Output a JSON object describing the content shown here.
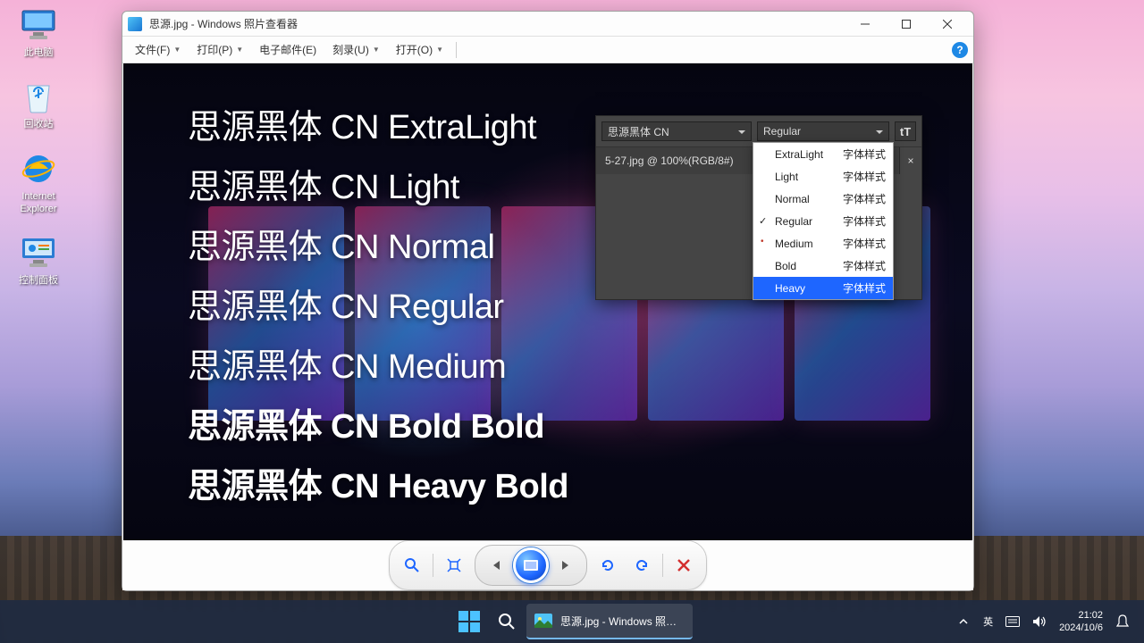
{
  "desktop": {
    "icons": [
      {
        "label": "此电脑"
      },
      {
        "label": "回收站"
      },
      {
        "label": "Internet\nExplorer"
      },
      {
        "label": "控制面板"
      }
    ]
  },
  "window": {
    "title": "思源.jpg - Windows 照片查看器",
    "menu": {
      "file": "文件(F)",
      "print": "打印(P)",
      "email": "电子邮件(E)",
      "burn": "刻录(U)",
      "open": "打开(O)"
    },
    "samples": [
      "思源黑体 CN ExtraLight",
      "思源黑体 CN Light",
      "思源黑体 CN Normal",
      "思源黑体 CN Regular",
      "思源黑体 CN Medium",
      "思源黑体 CN Bold Bold",
      "思源黑体 CN Heavy Bold"
    ],
    "panel": {
      "font_family": "思源黑体 CN",
      "font_style": "Regular",
      "tab": "5-27.jpg @ 100%(RGB/8#)",
      "type_glyph": "tT"
    },
    "dropdown": {
      "style_suffix": "字体样式",
      "items": [
        "ExtraLight",
        "Light",
        "Normal",
        "Regular",
        "Medium",
        "Bold",
        "Heavy"
      ],
      "checked": "Regular",
      "dotted": "Medium",
      "highlight": "Heavy"
    }
  },
  "taskbar": {
    "app_label": "思源.jpg - Windows 照片查看器",
    "ime": "英",
    "time": "21:02",
    "date": "2024/10/6"
  }
}
